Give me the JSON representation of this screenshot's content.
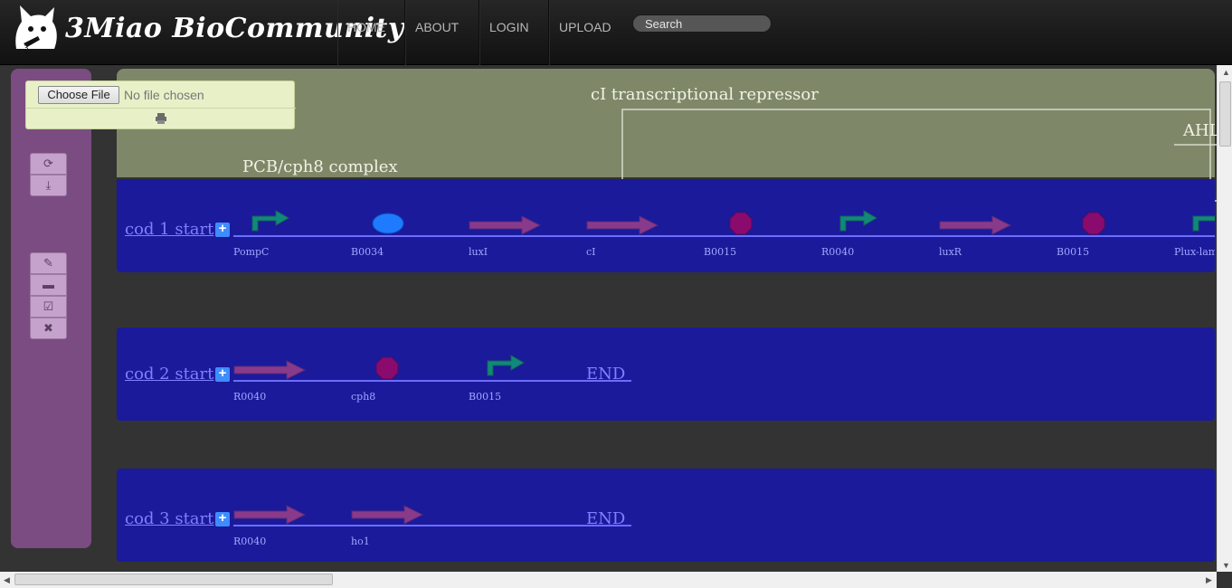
{
  "brand": {
    "name": "3Miao BioCommunity"
  },
  "nav": [
    "HOME",
    "ABOUT",
    "LOGIN",
    "UPLOAD"
  ],
  "search": {
    "placeholder": "Search"
  },
  "file_upload": {
    "button": "Choose File",
    "status": "No file chosen"
  },
  "annotations": {
    "cI": "cI transcriptional repressor",
    "pcb": "PCB/cph8 complex",
    "ahl": "AHL"
  },
  "constructs": [
    {
      "start": "cod 1 start",
      "parts": [
        {
          "name": "PompC",
          "shape": "promoter"
        },
        {
          "name": "B0034",
          "shape": "rbs"
        },
        {
          "name": "luxI",
          "shape": "cds"
        },
        {
          "name": "cI",
          "shape": "cds"
        },
        {
          "name": "B0015",
          "shape": "terminator"
        },
        {
          "name": "R0040",
          "shape": "promoter"
        },
        {
          "name": "luxR",
          "shape": "cds"
        },
        {
          "name": "B0015",
          "shape": "terminator"
        },
        {
          "name": "Plux-lam",
          "shape": "promoter"
        }
      ],
      "end": ""
    },
    {
      "start": "cod 2 start",
      "parts": [
        {
          "name": "R0040",
          "shape": "cds"
        },
        {
          "name": "cph8",
          "shape": "terminator"
        },
        {
          "name": "B0015",
          "shape": "promoter"
        }
      ],
      "end": "END"
    },
    {
      "start": "cod 3 start",
      "parts": [
        {
          "name": "R0040",
          "shape": "cds"
        },
        {
          "name": "ho1",
          "shape": "cds"
        }
      ],
      "end": "END"
    }
  ],
  "colors": {
    "row_bg": "#1a1a9b",
    "annotation_bg": "#7e8869",
    "sidepanel_bg": "#7b4c82",
    "cds": "#8a3a8a",
    "promoter": "#0f8a7a",
    "terminator": "#8b0a6e",
    "rbs": "#1e7bff"
  },
  "icons": [
    "refresh-icon",
    "download-icon",
    "pencil-icon",
    "folder-icon",
    "edit-icon",
    "close-icon",
    "print-icon",
    "plus-icon"
  ]
}
